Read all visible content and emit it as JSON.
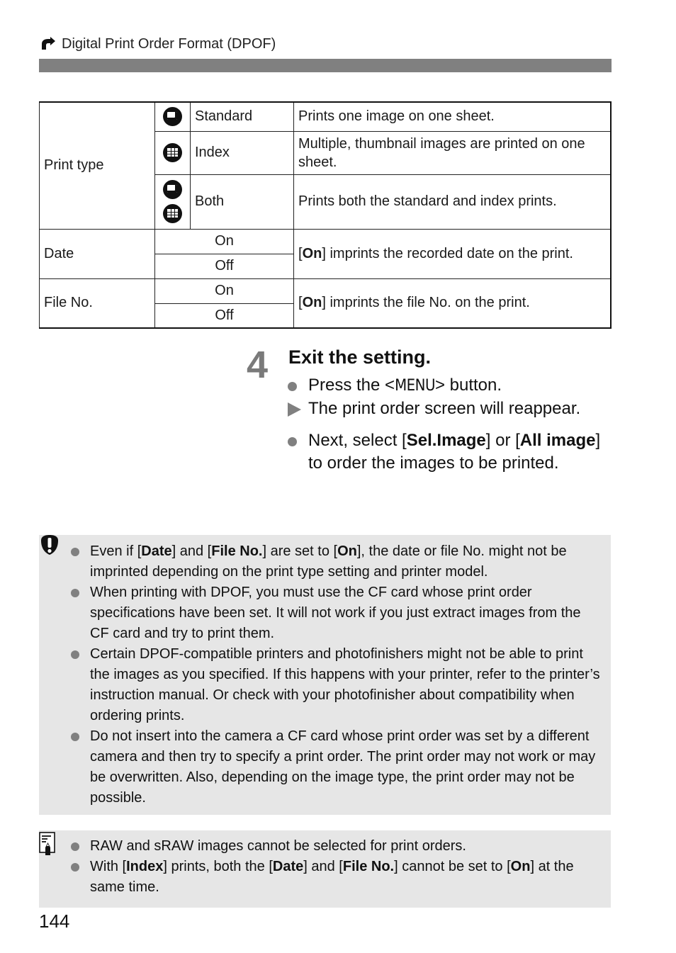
{
  "header": {
    "icon": "print-arrow-icon",
    "title": "Digital Print Order Format (DPOF)"
  },
  "table": {
    "print_type": {
      "label": "Print type",
      "options": [
        {
          "icons": [
            "standard-print-icon"
          ],
          "name": "Standard",
          "description": "Prints one image on one sheet."
        },
        {
          "icons": [
            "index-print-icon"
          ],
          "name": "Index",
          "description": "Multiple, thumbnail images are printed on one sheet."
        },
        {
          "icons": [
            "standard-print-icon",
            "index-print-icon"
          ],
          "name": "Both",
          "description": "Prints both the standard and index prints."
        }
      ]
    },
    "date": {
      "label": "Date",
      "on": "On",
      "off": "Off",
      "desc_bold": "On",
      "desc_rest": " imprints the recorded date on the print."
    },
    "file_no": {
      "label": "File No.",
      "on": "On",
      "off": "Off",
      "desc_bold": "On",
      "desc_rest": " imprints the file No. on the print."
    }
  },
  "step": {
    "number": "4",
    "title": "Exit the setting.",
    "item1_pre": "Press the <",
    "item1_button": "MENU",
    "item1_post": "> button.",
    "item2": "The print order screen will reappear.",
    "item3_a": "Next, select [",
    "item3_b": "Sel.Image",
    "item3_c": "] or [",
    "item3_d": "All image",
    "item3_e": "] to order the images to be printed."
  },
  "caution": {
    "icon": "caution-exclamation-icon",
    "items": [
      {
        "a": "Even if [",
        "b": "Date",
        "c": "] and [",
        "d": "File No.",
        "e": "] are set to [",
        "f": "On",
        "g": "], the date or file No. might not be imprinted depending on the print type setting and printer model."
      },
      {
        "text": "When printing with DPOF, you must use the CF card whose print order specifications have been set. It will not work if you just extract images from the CF card and try to print them."
      },
      {
        "text": "Certain DPOF-compatible printers and photofinishers might not be able to print the images as you specified. If this happens with your printer, refer to the printer’s instruction manual. Or check with your photofinisher about compatibility when ordering prints."
      },
      {
        "text": "Do not insert into the camera a CF card whose print order was set by a different camera and then try to specify a print order. The print order may not work or may be overwritten. Also, depending on the image type, the print order may not be possible."
      }
    ]
  },
  "note": {
    "icon": "memo-pencil-icon",
    "items": [
      {
        "text": "RAW and sRAW images cannot be selected for print orders."
      },
      {
        "a": "With [",
        "b": "Index",
        "c": "] prints, both the [",
        "d": "Date",
        "e": "] and [",
        "f": "File No.",
        "g": "] cannot be set to [",
        "h": "On",
        "i": "] at the same time."
      }
    ]
  },
  "page_number": "144"
}
